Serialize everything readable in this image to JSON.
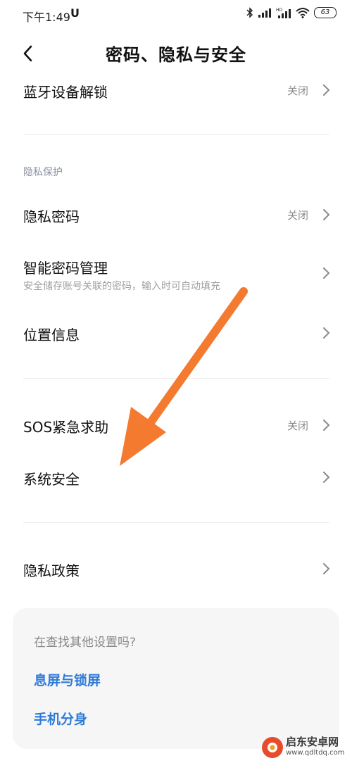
{
  "status_bar": {
    "time": "下午1:49",
    "extra_icon": "U",
    "battery": "63",
    "icons": [
      "bluetooth-icon",
      "signal-icon",
      "signal-hd-icon",
      "wifi-icon",
      "battery-icon"
    ]
  },
  "header": {
    "title": "密码、隐私与安全",
    "back_icon": "chevron-left-icon"
  },
  "rows": {
    "bluetooth_unlock": {
      "title": "蓝牙设备解锁",
      "value": "关闭"
    },
    "privacy_section_label": "隐私保护",
    "privacy_password": {
      "title": "隐私密码",
      "value": "关闭"
    },
    "smart_password": {
      "title": "智能密码管理",
      "subtitle": "安全储存账号关联的密码，输入时可自动填充"
    },
    "location": {
      "title": "位置信息"
    },
    "sos": {
      "title": "SOS紧急求助",
      "value": "关闭"
    },
    "system_security": {
      "title": "系统安全"
    },
    "privacy_policy": {
      "title": "隐私政策"
    }
  },
  "search_card": {
    "title": "在查找其他设置吗?",
    "links": [
      "息屏与锁屏",
      "手机分身"
    ]
  },
  "annotation": {
    "arrow_color": "#f47a30"
  },
  "watermark": {
    "text": "启东安卓网",
    "url": "www.qdltdq.com"
  },
  "colors": {
    "link": "#2f7bd8",
    "muted": "#8a8a8a",
    "card_bg": "#f6f6f6"
  }
}
